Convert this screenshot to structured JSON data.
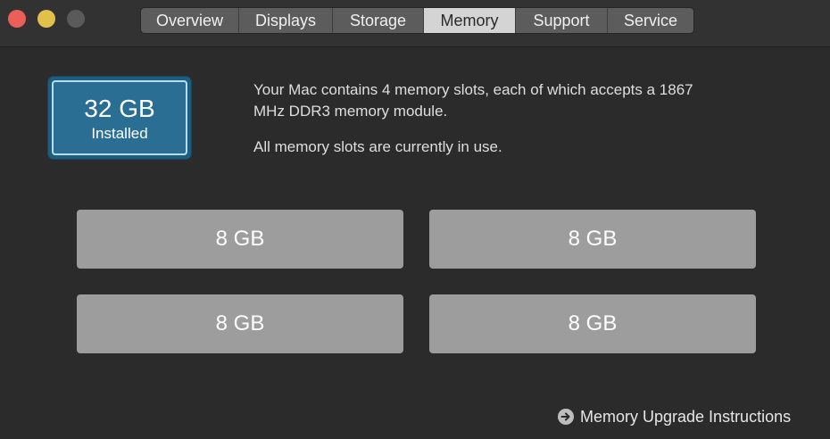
{
  "window": {
    "traffic_lights": {
      "close_color": "#ec5f59",
      "minimize_color": "#e1c04c",
      "zoom_color": "#5a5a5a"
    }
  },
  "tabs": [
    {
      "label": "Overview",
      "active": false
    },
    {
      "label": "Displays",
      "active": false
    },
    {
      "label": "Storage",
      "active": false
    },
    {
      "label": "Memory",
      "active": true
    },
    {
      "label": "Support",
      "active": false
    },
    {
      "label": "Service",
      "active": false
    }
  ],
  "memory": {
    "installed": {
      "size": "32 GB",
      "label": "Installed",
      "accent_color": "#2a6f93"
    },
    "description": {
      "line1": "Your Mac contains 4 memory slots, each of which accepts a 1867 MHz DDR3 memory module.",
      "line2": "All memory slots are currently in use."
    },
    "slots": [
      {
        "size": "8 GB"
      },
      {
        "size": "8 GB"
      },
      {
        "size": "8 GB"
      },
      {
        "size": "8 GB"
      }
    ],
    "upgrade_link": {
      "label": "Memory Upgrade Instructions",
      "icon": "arrow-right-circle-icon"
    }
  }
}
